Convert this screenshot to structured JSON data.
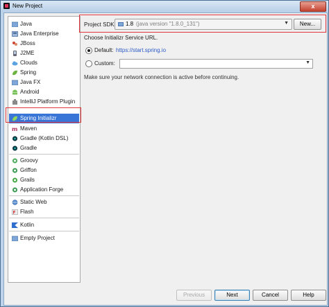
{
  "window": {
    "title": "New Project",
    "close_label": "x"
  },
  "sidebar": {
    "items": [
      {
        "label": "Java",
        "icon": "java-folder-icon"
      },
      {
        "label": "Java Enterprise",
        "icon": "java-enterprise-icon"
      },
      {
        "label": "JBoss",
        "icon": "jboss-icon"
      },
      {
        "label": "J2ME",
        "icon": "j2me-icon"
      },
      {
        "label": "Clouds",
        "icon": "clouds-icon"
      },
      {
        "label": "Spring",
        "icon": "spring-icon"
      },
      {
        "label": "Java FX",
        "icon": "javafx-icon"
      },
      {
        "label": "Android",
        "icon": "android-icon"
      },
      {
        "label": "IntelliJ Platform Plugin",
        "icon": "plugin-icon"
      },
      {
        "label": "Spring Initializr",
        "icon": "spring-initializr-icon"
      },
      {
        "label": "Maven",
        "icon": "maven-icon"
      },
      {
        "label": "Gradle (Kotlin DSL)",
        "icon": "gradle-kotlin-icon"
      },
      {
        "label": "Gradle",
        "icon": "gradle-icon"
      },
      {
        "label": "Groovy",
        "icon": "groovy-icon"
      },
      {
        "label": "Griffon",
        "icon": "griffon-icon"
      },
      {
        "label": "Grails",
        "icon": "grails-icon"
      },
      {
        "label": "Application Forge",
        "icon": "application-forge-icon"
      },
      {
        "label": "Static Web",
        "icon": "static-web-icon"
      },
      {
        "label": "Flash",
        "icon": "flash-icon"
      },
      {
        "label": "Kotlin",
        "icon": "kotlin-icon"
      },
      {
        "label": "Empty Project",
        "icon": "empty-project-icon"
      }
    ],
    "selected": "Spring Initializr"
  },
  "sdk": {
    "label": "Project SDK:",
    "version": "1.8",
    "java_version": "(java version \"1.8.0_131\")",
    "new_button": "New..."
  },
  "initializr": {
    "choose_label": "Choose Initializr Service URL.",
    "default_label": "Default:",
    "default_url": "https://start.spring.io",
    "custom_label": "Custom:",
    "custom_value": "",
    "note": "Make sure your network connection is active before continuing."
  },
  "footer": {
    "previous": "Previous",
    "next": "Next",
    "cancel": "Cancel",
    "help": "Help"
  },
  "colors": {
    "selection": "#3875d7",
    "highlight_border": "#e0353c",
    "link": "#2a59c4"
  }
}
